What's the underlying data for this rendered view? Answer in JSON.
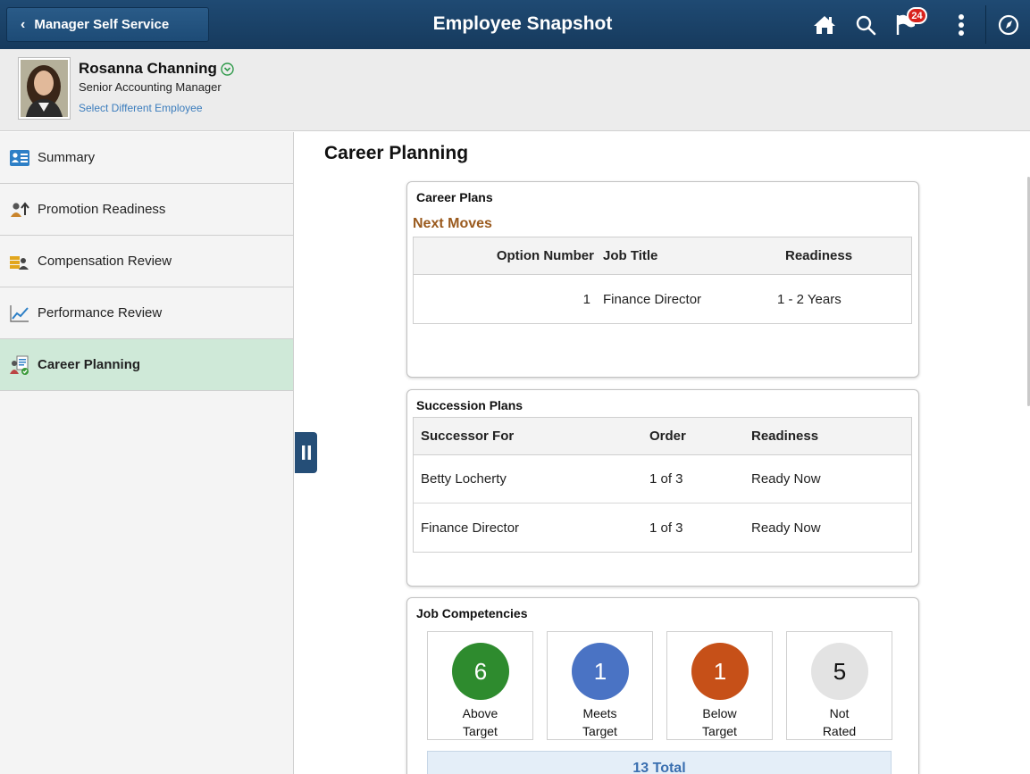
{
  "banner": {
    "back_label": "Manager Self Service",
    "title": "Employee Snapshot",
    "notification_count": "24",
    "icons": [
      "home-icon",
      "search-icon",
      "notification-flag-icon",
      "actions-menu-icon",
      "navbar-compass-icon"
    ]
  },
  "employee": {
    "name": "Rosanna Channing",
    "job_title": "Senior Accounting Manager",
    "select_link": "Select Different Employee"
  },
  "nav": {
    "items": [
      {
        "label": "Summary",
        "icon": "summary-card-icon",
        "active": false
      },
      {
        "label": "Promotion Readiness",
        "icon": "promotion-icon",
        "active": false
      },
      {
        "label": "Compensation Review",
        "icon": "compensation-icon",
        "active": false
      },
      {
        "label": "Performance Review",
        "icon": "trend-chart-icon",
        "active": false
      },
      {
        "label": "Career Planning",
        "icon": "career-planning-icon",
        "active": true
      }
    ]
  },
  "main": {
    "section_title": "Career Planning",
    "career_plans": {
      "title": "Career Plans",
      "subtitle": "Next Moves",
      "columns": [
        "Option Number",
        "Job Title",
        "Readiness"
      ],
      "rows": [
        {
          "option": "1",
          "job_title": "Finance Director",
          "readiness": "1 - 2 Years"
        }
      ]
    },
    "succession_plans": {
      "title": "Succession Plans",
      "columns": [
        "Successor For",
        "Order",
        "Readiness"
      ],
      "rows": [
        {
          "successor_for": "Betty Locherty",
          "order": "1 of 3",
          "readiness": "Ready Now"
        },
        {
          "successor_for": "Finance Director",
          "order": "1 of 3",
          "readiness": "Ready Now"
        }
      ]
    },
    "job_competencies": {
      "title": "Job Competencies",
      "tiles": [
        {
          "count": "6",
          "line1": "Above",
          "line2": "Target",
          "color": "#2e8b2e",
          "text_color": "#ffffff"
        },
        {
          "count": "1",
          "line1": "Meets",
          "line2": "Target",
          "color": "#4a73c4",
          "text_color": "#ffffff"
        },
        {
          "count": "1",
          "line1": "Below",
          "line2": "Target",
          "color": "#c65018",
          "text_color": "#ffffff"
        },
        {
          "count": "5",
          "line1": "Not",
          "line2": "Rated",
          "color": "#e3e3e3",
          "text_color": "#111111"
        }
      ],
      "total": "13 Total"
    }
  },
  "colors": {
    "banner": "#1f4a73",
    "active_nav": "#cfe9d8",
    "accent_link": "#3c7dbd",
    "subtitle": "#9a5a1e"
  }
}
